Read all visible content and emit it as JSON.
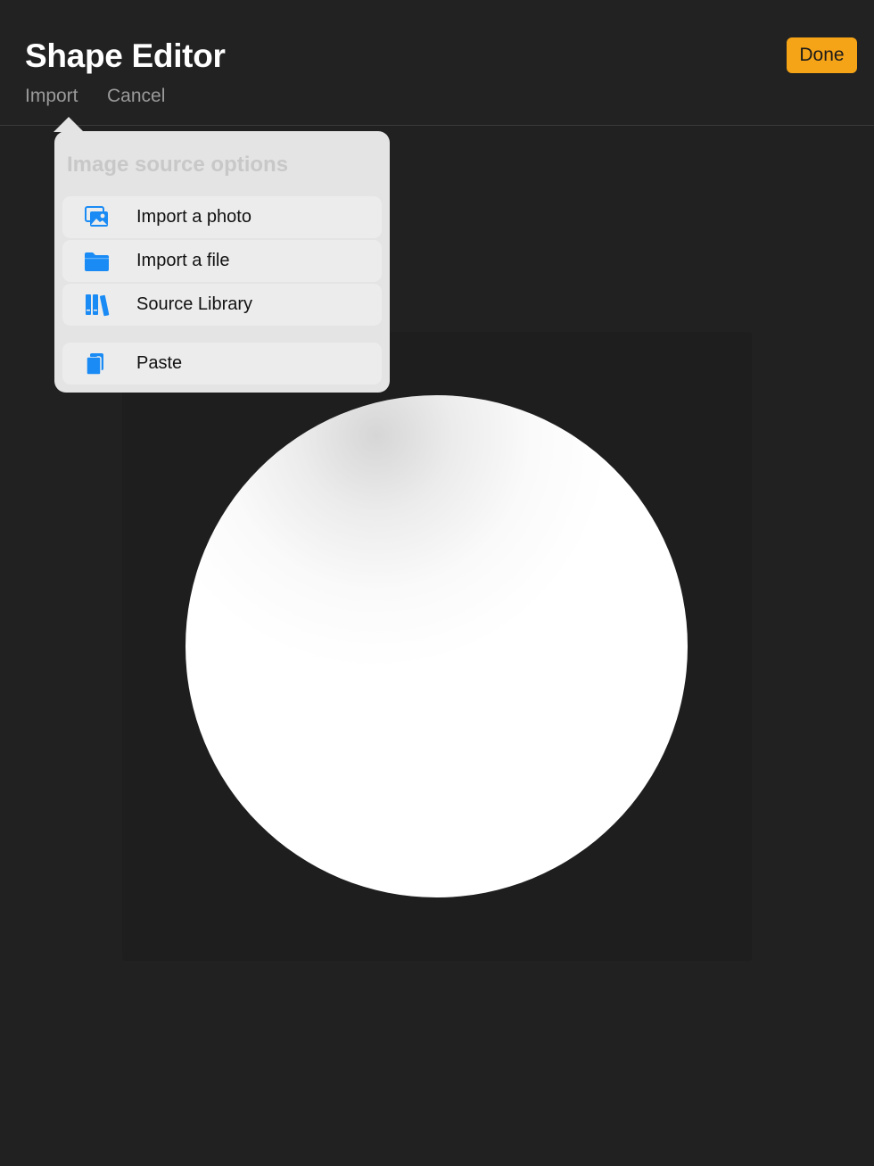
{
  "header": {
    "title": "Shape Editor",
    "import_label": "Import",
    "cancel_label": "Cancel",
    "done_label": "Done"
  },
  "colors": {
    "accent": "#f6a417",
    "icon_blue": "#1a8bf5",
    "background": "#212121"
  },
  "popover": {
    "title": "Image source options",
    "items": [
      {
        "label": "Import a photo",
        "icon": "photo-icon"
      },
      {
        "label": "Import a file",
        "icon": "folder-icon"
      },
      {
        "label": "Source Library",
        "icon": "library-icon"
      },
      {
        "label": "Paste",
        "icon": "paste-icon"
      }
    ]
  }
}
